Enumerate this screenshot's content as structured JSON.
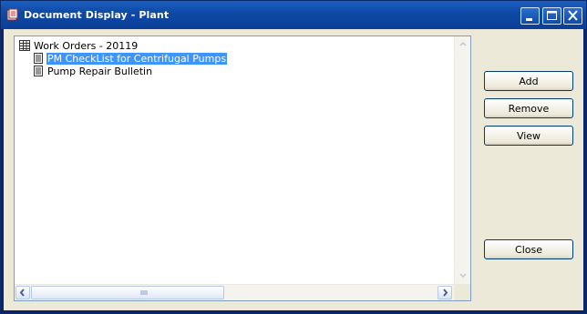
{
  "window": {
    "title": "Document Display - Plant",
    "controls": {
      "minimize": "minimize",
      "maximize": "maximize",
      "close": "close"
    }
  },
  "tree": {
    "items": [
      {
        "label": "Work Orders - 20119",
        "icon": "table-icon",
        "selected": false
      },
      {
        "label": "PM CheckList for Centrifugal Pumps",
        "icon": "document-icon",
        "selected": true
      },
      {
        "label": "Pump Repair Bulletin",
        "icon": "document-icon",
        "selected": false
      }
    ]
  },
  "buttons": {
    "add": "Add",
    "remove": "Remove",
    "view": "View",
    "close": "Close"
  },
  "colors": {
    "titlebar": "#0b3e96",
    "selection": "#3d95ff",
    "client": "#ece9d8",
    "button_border": "#003c74"
  }
}
